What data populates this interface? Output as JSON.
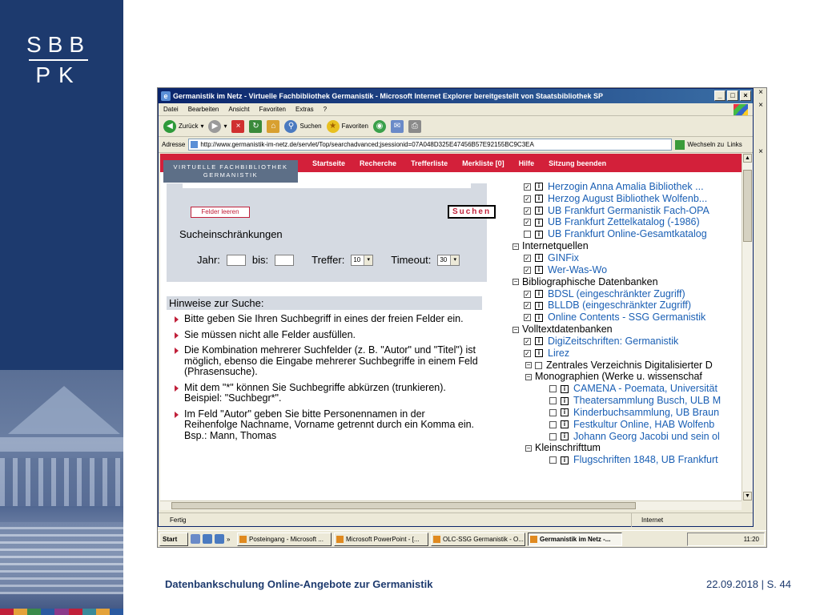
{
  "brand": {
    "line1": "SBB",
    "line2": "PK"
  },
  "window": {
    "title": "Germanistik im Netz - Virtuelle Fachbibliothek Germanistik - Microsoft Internet Explorer bereitgestellt von Staatsbibliothek SP",
    "menu": [
      "Datei",
      "Bearbeiten",
      "Ansicht",
      "Favoriten",
      "Extras",
      "?"
    ],
    "toolbar": {
      "back": "Zurück",
      "search": "Suchen",
      "favorites": "Favoriten"
    },
    "address_label": "Adresse",
    "address_value": "http://www.germanistik-im-netz.de/servlet/Top/searchadvanced;jsessionid=07A048D325E47456B57E92155BC9C3EA",
    "go_label": "Wechseln zu",
    "links_label": "Links",
    "status": "Fertig",
    "zone": "Internet"
  },
  "site": {
    "logo_line1": "VIRTUELLE FACHBIBLIOTHEK",
    "logo_line2": "GERMANISTIK",
    "nav": [
      "Startseite",
      "Recherche",
      "Trefferliste",
      "Merkliste [0]",
      "Hilfe",
      "Sitzung beenden"
    ]
  },
  "form": {
    "clear_button": "Felder leeren",
    "search_button": "Suchen",
    "restrictions_title": "Sucheinschränkungen",
    "year_label": "Jahr:",
    "to_label": "bis:",
    "hits_label": "Treffer:",
    "hits_value": "10",
    "timeout_label": "Timeout:",
    "timeout_value": "30"
  },
  "hints": {
    "title": "Hinweise zur Suche:",
    "items": [
      "Bitte geben Sie Ihren Suchbegriff in eines der freien Felder ein.",
      "Sie müssen nicht alle Felder ausfüllen.",
      "Die Kombination mehrerer Suchfelder (z. B. \"Autor\" und \"Titel\") ist möglich, ebenso die Eingabe mehrerer Suchbegriffe in einem Feld (Phrasensuche).",
      "Mit dem \"*\" können Sie Suchbegriffe abkürzen (trunkieren). Beispiel: \"Suchbegr*\".",
      "Im Feld \"Autor\" geben Sie bitte Personennamen in der Reihenfolge Nachname, Vorname getrennt durch ein Komma ein. Bsp.: Mann, Thomas"
    ]
  },
  "tree": [
    {
      "kind": "item",
      "indent": 0,
      "checked": true,
      "text": "Herzogin Anna Amalia Bibliothek ..."
    },
    {
      "kind": "item",
      "indent": 0,
      "checked": true,
      "text": "Herzog August Bibliothek Wolfenb..."
    },
    {
      "kind": "item",
      "indent": 0,
      "checked": true,
      "text": "UB Frankfurt Germanistik Fach-OPA"
    },
    {
      "kind": "item",
      "indent": 0,
      "checked": true,
      "text": "UB Frankfurt Zettelkatalog (-1986)"
    },
    {
      "kind": "item",
      "indent": 0,
      "checked": false,
      "text": "UB Frankfurt Online-Gesamtkatalog"
    },
    {
      "kind": "group",
      "indent": 0,
      "text": "Internetquellen"
    },
    {
      "kind": "item",
      "indent": 0,
      "checked": true,
      "text": "GINFix"
    },
    {
      "kind": "item",
      "indent": 0,
      "checked": true,
      "text": "Wer-Was-Wo"
    },
    {
      "kind": "group",
      "indent": 0,
      "text": "Bibliographische Datenbanken"
    },
    {
      "kind": "item",
      "indent": 0,
      "checked": true,
      "text": "BDSL (eingeschränkter Zugriff)"
    },
    {
      "kind": "item",
      "indent": 0,
      "checked": true,
      "text": "BLLDB (eingeschränkter Zugriff)"
    },
    {
      "kind": "item",
      "indent": 0,
      "checked": true,
      "text": "Online Contents - SSG Germanistik"
    },
    {
      "kind": "group",
      "indent": 0,
      "text": "Volltextdatenbanken"
    },
    {
      "kind": "item",
      "indent": 0,
      "checked": true,
      "text": "DigiZeitschriften: Germanistik"
    },
    {
      "kind": "item",
      "indent": 0,
      "checked": true,
      "text": "Lirez"
    },
    {
      "kind": "group2",
      "indent": 1,
      "text": "Zentrales Verzeichnis Digitalisierter D"
    },
    {
      "kind": "group",
      "indent": 1,
      "text": "Monographien (Werke u. wissenschaf"
    },
    {
      "kind": "item",
      "indent": 2,
      "checked": false,
      "text": "CAMENA - Poemata, Universität"
    },
    {
      "kind": "item",
      "indent": 2,
      "checked": false,
      "text": "Theatersammlung Busch, ULB M"
    },
    {
      "kind": "item",
      "indent": 2,
      "checked": false,
      "text": "Kinderbuchsammlung, UB Braun"
    },
    {
      "kind": "item",
      "indent": 2,
      "checked": false,
      "text": "Festkultur Online, HAB Wolfenb"
    },
    {
      "kind": "item",
      "indent": 2,
      "checked": false,
      "text": "Johann Georg Jacobi und sein ol"
    },
    {
      "kind": "group",
      "indent": 1,
      "text": "Kleinschrifttum"
    },
    {
      "kind": "item",
      "indent": 2,
      "checked": false,
      "text": "Flugschriften 1848, UB Frankfurt"
    }
  ],
  "taskbar": {
    "start": "Start",
    "tasks": [
      "Posteingang - Microsoft ...",
      "Microsoft PowerPoint - [...",
      "OLC-SSG Germanistik - O...",
      "Germanistik im Netz -..."
    ],
    "clock": "11:20"
  },
  "footer": {
    "left": "Datenbankschulung Online-Angebote zur Germanistik",
    "right": "22.09.2018 | S. 44"
  },
  "colors": {
    "brand_blue": "#1d3a6e",
    "nav_red": "#d3203a",
    "link_blue": "#1a5fb4",
    "panel_gray": "#d5dae2"
  }
}
